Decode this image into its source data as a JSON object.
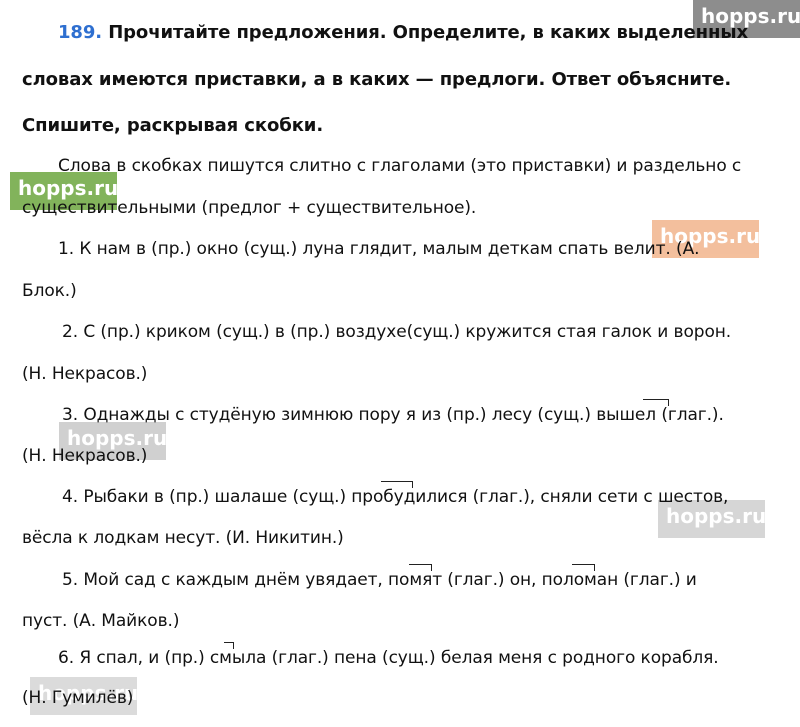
{
  "watermark": "hopps.ru",
  "task": {
    "number": "189.",
    "line1": "Прочитайте предложения. Определите, в каких выделенных",
    "line2": "словах имеются приставки, а в каких — предлоги. Ответ объясните.",
    "line3": "Спишите, раскрывая скобки."
  },
  "intro": {
    "line1": "Слова в скобках пишутся слитно с глаголами (это приставки) и раздельно с",
    "line2": "существительными (предлог + существительное)."
  },
  "items": [
    {
      "line1": "1. К нам в (пр.) окно (сущ.) луна глядит, малым деткам спать велит. (А.",
      "line2": "Блок.)"
    },
    {
      "line1": "2. С (пр.)  криком (сущ.)  в (пр.)  воздухе(сущ.)  кружится стая галок и ворон.",
      "line2": "(Н. Некрасов.)"
    },
    {
      "line1": "3. Однажды с студёную зимнюю пору я из (пр.) лесу (сущ.)  вышел (глаг.).",
      "line2": "(Н. Некрасов.)"
    },
    {
      "line1": "4. Рыбаки в (пр.)  шалаше (сущ.)  пробудилися (глаг.), сняли сети с шестов,",
      "line2": "вёсла к лодкам несут. (И. Никитин.)"
    },
    {
      "line1": "5. Мой сад с каждым днём увядает, помят (глаг.) он, поломан (глаг.) и",
      "line2": "пуст. (А. Майков.)"
    },
    {
      "line1": "6. Я спал, и (пр.) смыла (глаг.) пена (сущ.) белая меня с родного корабля.",
      "line2": "(Н. Гумилёв)"
    }
  ]
}
